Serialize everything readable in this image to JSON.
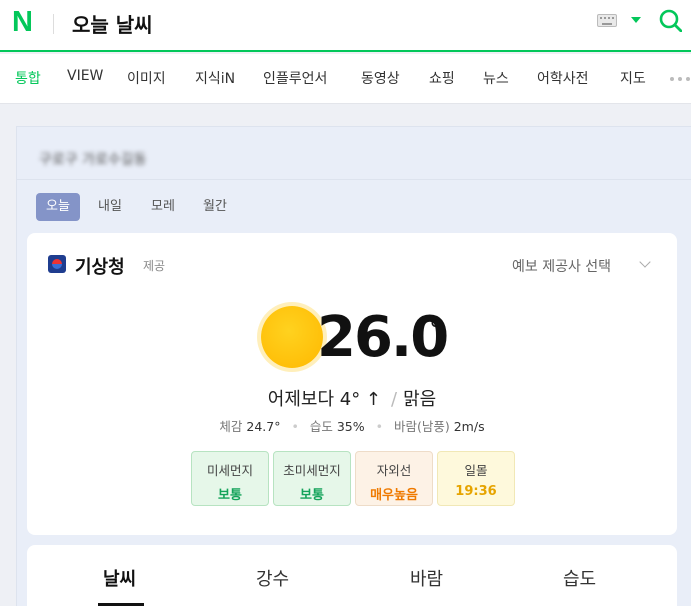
{
  "header": {
    "logo": "N",
    "query": "오늘 날씨",
    "icons": {
      "keyboard": "keyboard-icon",
      "dropdown": "chevron-down-icon",
      "search": "search-icon"
    },
    "accent": "#03c75a"
  },
  "tabs": [
    {
      "label": "통합",
      "active": true
    },
    {
      "label": "VIEW"
    },
    {
      "label": "이미지"
    },
    {
      "label": "지식iN"
    },
    {
      "label": "인플루언서"
    },
    {
      "label": "동영상"
    },
    {
      "label": "쇼핑"
    },
    {
      "label": "뉴스"
    },
    {
      "label": "어학사전"
    },
    {
      "label": "지도"
    }
  ],
  "weather": {
    "location_blurred": "구로구 가로수길동",
    "day_tabs": [
      {
        "label": "오늘",
        "active": true
      },
      {
        "label": "내일"
      },
      {
        "label": "모레"
      },
      {
        "label": "월간"
      }
    ],
    "provider": "기상청",
    "provider_suffix": "제공",
    "select_provider": "예보 제공사 선택",
    "temperature": "26.0",
    "temperature_unit": "°",
    "comparison": "어제보다 4° ↑",
    "condition": "맑음",
    "details": {
      "feels_label": "체감",
      "feels_value": "24.7°",
      "humidity_label": "습도",
      "humidity_value": "35%",
      "wind_label": "바람(남풍)",
      "wind_value": "2m/s"
    },
    "chips": [
      {
        "label": "미세먼지",
        "value": "보통",
        "tone": "#14a35a"
      },
      {
        "label": "초미세먼지",
        "value": "보통",
        "tone": "#14a35a"
      },
      {
        "label": "자외선",
        "value": "매우높음",
        "tone": "#ef7a00"
      },
      {
        "label": "일몰",
        "value": "19:36",
        "tone": "#e6a400"
      }
    ]
  },
  "bottom_tabs": [
    {
      "label": "날씨",
      "active": true
    },
    {
      "label": "강수"
    },
    {
      "label": "바람"
    },
    {
      "label": "습도"
    }
  ]
}
